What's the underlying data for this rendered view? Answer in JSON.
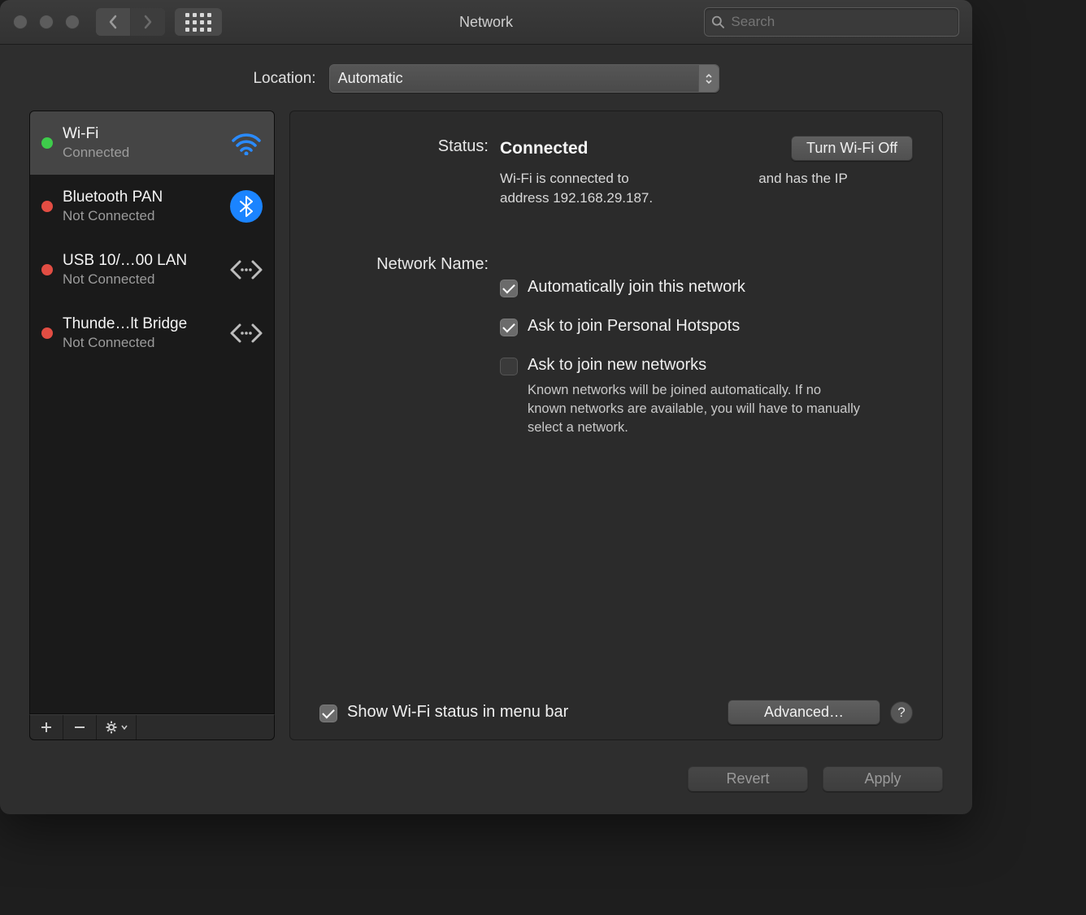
{
  "window": {
    "title": "Network"
  },
  "search": {
    "placeholder": "Search"
  },
  "location": {
    "label": "Location:",
    "value": "Automatic"
  },
  "sidebar": {
    "items": [
      {
        "name": "Wi-Fi",
        "status": "Connected",
        "dot": "green",
        "icon": "wifi",
        "selected": true
      },
      {
        "name": "Bluetooth PAN",
        "status": "Not Connected",
        "dot": "red",
        "icon": "bluetooth"
      },
      {
        "name": "USB 10/…00 LAN",
        "status": "Not Connected",
        "dot": "red",
        "icon": "ethernet"
      },
      {
        "name": "Thunde…lt Bridge",
        "status": "Not Connected",
        "dot": "red",
        "icon": "ethernet"
      }
    ]
  },
  "detail": {
    "status_label": "Status:",
    "status_value": "Connected",
    "wifi_toggle": "Turn Wi-Fi Off",
    "status_desc_prefix": "Wi-Fi is connected to",
    "status_desc_mid": "and has the IP address",
    "ip": "192.168.29.187",
    "status_desc_suffix": ".",
    "network_name_label": "Network Name:",
    "checks": [
      {
        "label": "Automatically join this network",
        "checked": true
      },
      {
        "label": "Ask to join Personal Hotspots",
        "checked": true
      },
      {
        "label": "Ask to join new networks",
        "checked": false,
        "desc": "Known networks will be joined automatically. If no known networks are available, you will have to manually select a network."
      }
    ],
    "menubar_check": {
      "label": "Show Wi-Fi status in menu bar",
      "checked": true
    },
    "advanced": "Advanced…",
    "help": "?"
  },
  "footer": {
    "revert": "Revert",
    "apply": "Apply"
  }
}
